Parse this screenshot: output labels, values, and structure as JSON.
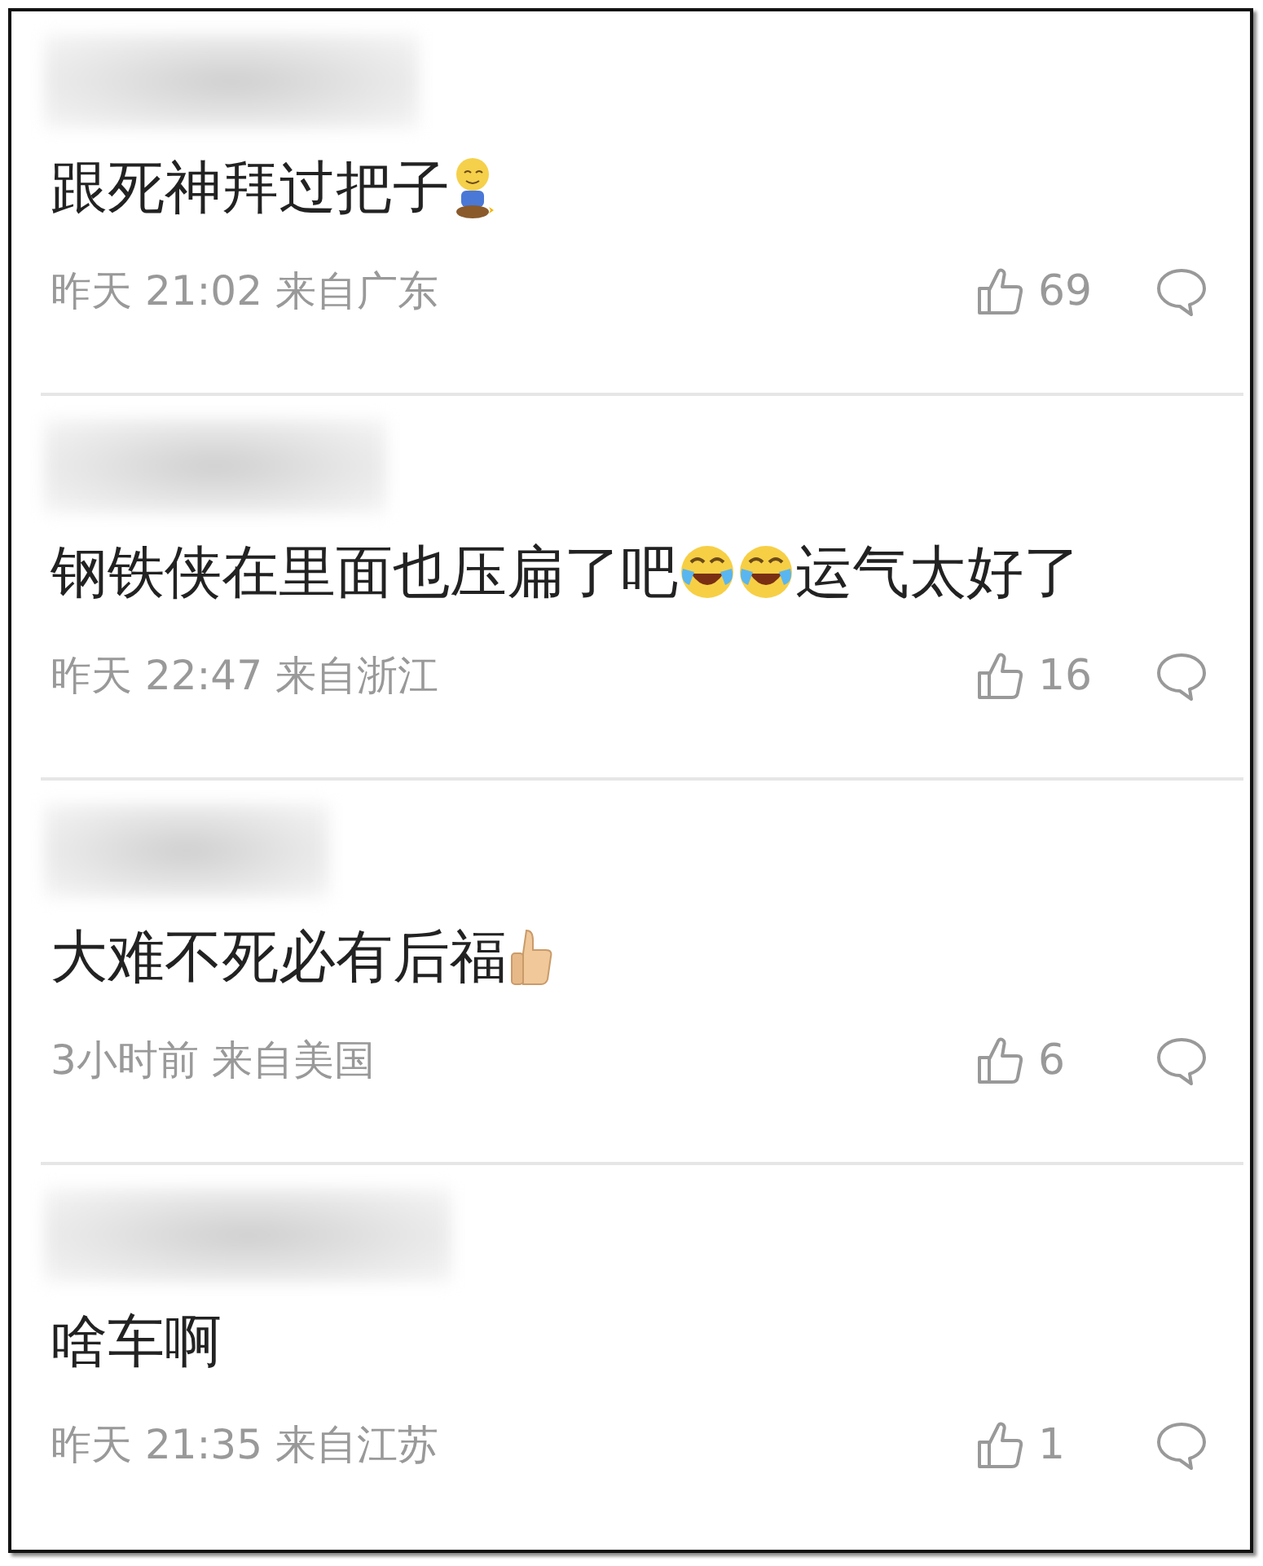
{
  "comments": [
    {
      "parts": [
        {
          "kind": "text",
          "text": "跟死神拜过把子"
        },
        {
          "kind": "kneeling"
        }
      ],
      "time": "昨天 21:02",
      "location": "来自广东",
      "likes": "69"
    },
    {
      "parts": [
        {
          "kind": "text",
          "text": "钢铁侠在里面也压扁了吧"
        },
        {
          "kind": "laughcry"
        },
        {
          "kind": "laughcry"
        },
        {
          "kind": "text",
          "text": "运气太好了"
        }
      ],
      "time": "昨天 22:47",
      "location": "来自浙江",
      "likes": "16"
    },
    {
      "parts": [
        {
          "kind": "text",
          "text": "大难不死必有后福"
        },
        {
          "kind": "thumbsup"
        }
      ],
      "time": "3小时前",
      "location": "来自美国",
      "likes": "6"
    },
    {
      "parts": [
        {
          "kind": "text",
          "text": "啥车啊"
        }
      ],
      "time": "昨天 21:35",
      "location": "来自江苏",
      "likes": "1"
    }
  ]
}
